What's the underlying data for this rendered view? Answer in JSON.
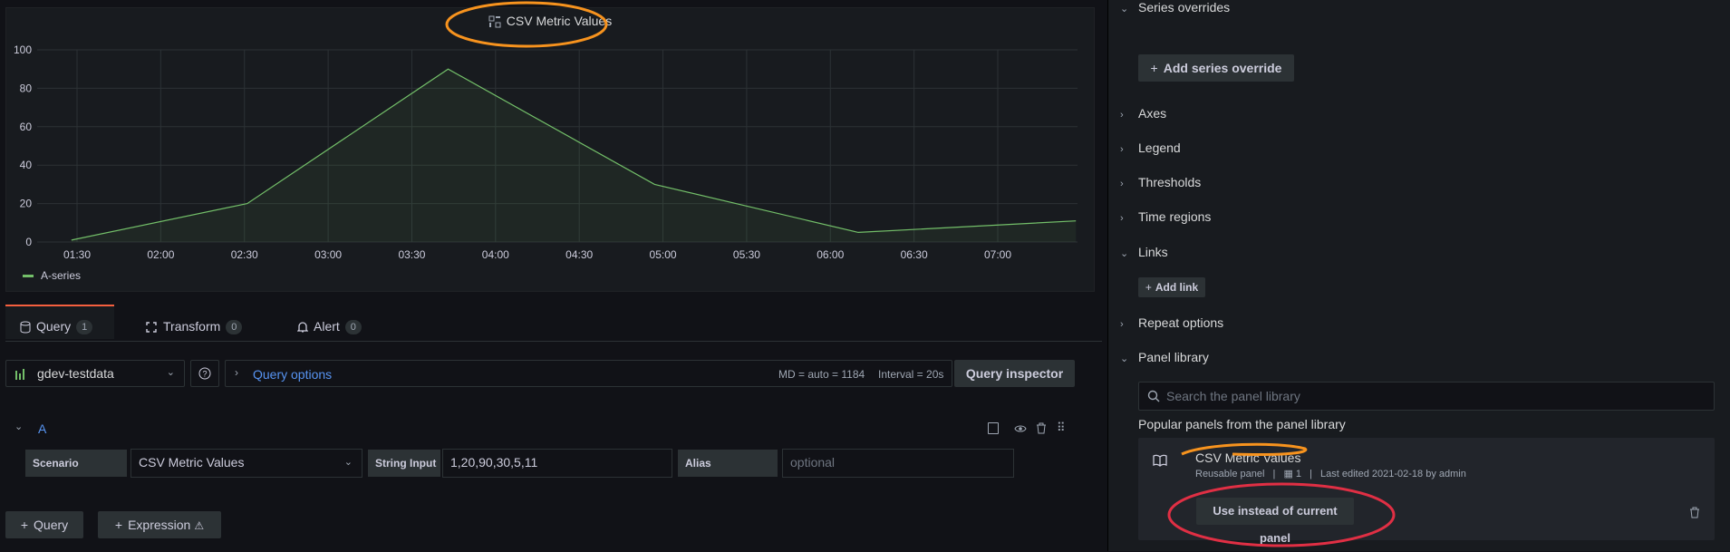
{
  "panel": {
    "title": "CSV Metric Values",
    "legend": "A-series",
    "accent": "#73bf69"
  },
  "chart_data": {
    "type": "area",
    "series": [
      {
        "name": "A-series",
        "x": [
          "01:28",
          "02:31",
          "03:43",
          "04:57",
          "06:10",
          "07:28"
        ],
        "values": [
          1,
          20,
          90,
          30,
          5,
          11
        ]
      }
    ],
    "x_ticks": [
      "01:30",
      "02:00",
      "02:30",
      "03:00",
      "03:30",
      "04:00",
      "04:30",
      "05:00",
      "05:30",
      "06:00",
      "06:30",
      "07:00"
    ],
    "y_ticks": [
      "0",
      "20",
      "40",
      "60",
      "80",
      "100"
    ],
    "ylim": [
      0,
      100
    ],
    "grid": true,
    "legend": "bottom-left"
  },
  "tabs": [
    {
      "label": "Query",
      "count": "1"
    },
    {
      "label": "Transform",
      "count": "0"
    },
    {
      "label": "Alert",
      "count": "0"
    }
  ],
  "datasource": {
    "name": "gdev-testdata",
    "query_options": "Query options",
    "info": "MD = auto = 1184",
    "interval": "Interval = 20s",
    "inspector": "Query inspector"
  },
  "query": {
    "ref": "A",
    "scenario_label": "Scenario",
    "scenario_value": "CSV Metric Values",
    "string_input_label": "String Input",
    "string_input_value": "1,20,90,30,5,11",
    "alias_label": "Alias",
    "alias_placeholder": "optional"
  },
  "add": {
    "query": "Query",
    "expression": "Expression"
  },
  "options": {
    "series_overrides": "Series overrides",
    "add_series_override": "Add series override",
    "axes": "Axes",
    "legend": "Legend",
    "thresholds": "Thresholds",
    "time_regions": "Time regions",
    "links": "Links",
    "add_link": "Add link",
    "repeat_options": "Repeat options",
    "panel_library": "Panel library",
    "search_placeholder": "Search the panel library",
    "popular": "Popular panels from the panel library",
    "lib_title": "CSV Metric Values",
    "lib_type": "Reusable panel",
    "lib_count": "1",
    "lib_edited": "Last edited 2021-02-18 by admin",
    "use_instead": "Use instead of current panel"
  }
}
